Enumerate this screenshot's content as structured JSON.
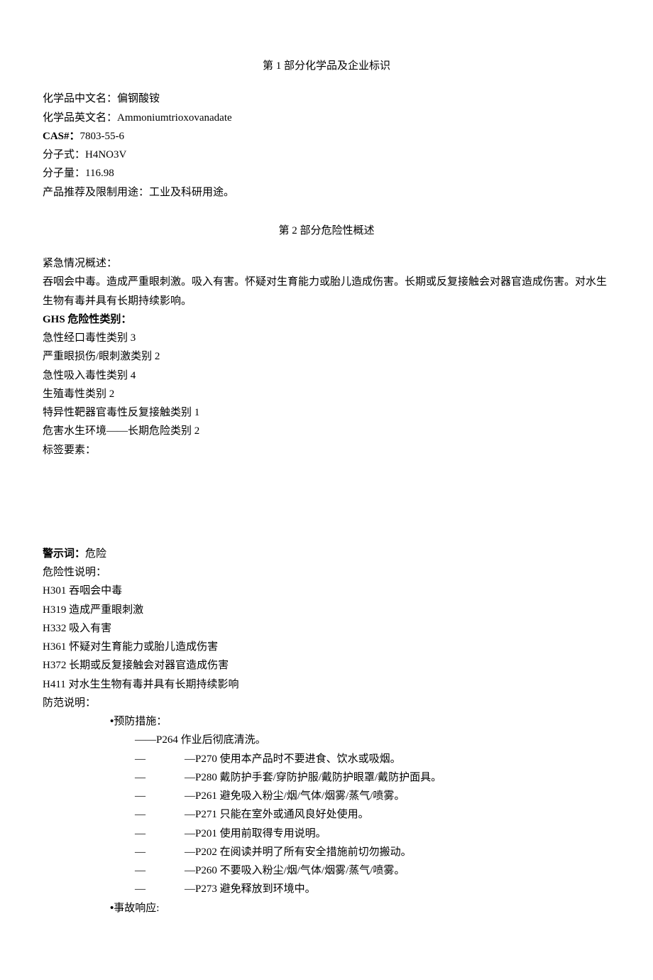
{
  "section1": {
    "title": "第 1 部分化学品及企业标识",
    "chinese_name_label": "化学品中文名：",
    "chinese_name_value": "偏钢酸铵",
    "english_name_label": "化学品英文名：",
    "english_name_value": "Ammoniumtrioxovanadate",
    "cas_label": "CAS#：",
    "cas_value": "7803-55-6",
    "formula_label": "分子式：",
    "formula_value": "H4NO3V",
    "mw_label": "分子量：",
    "mw_value": "116.98",
    "use_label": "产品推荐及限制用途：",
    "use_value": "工业及科研用途。"
  },
  "section2": {
    "title": "第 2 部分危险性概述",
    "emergency_label": "紧急情况概述：",
    "emergency_text": "吞咽会中毒。造成严重眼刺激。吸入有害。怀疑对生育能力或胎儿造成伤害。长期或反复接触会对器官造成伤害。对水生生物有毒并具有长期持续影响。",
    "ghs_label": "GHS 危险性类别：",
    "ghs_categories": [
      "急性经口毒性类别 3",
      "严重眼损伤/眼刺激类别 2",
      "急性吸入毒性类别 4",
      "生殖毒性类别 2",
      "特异性靶器官毒性反复接触类别 1",
      "危害水生环境——长期危险类别 2"
    ],
    "label_elements": "标签要素：",
    "signal_label": "警示词：",
    "signal_value": "危险",
    "hazard_label": "危险性说明：",
    "hazard_statements": [
      "H301 吞咽会中毒",
      "H319 造成严重眼刺激",
      "H332 吸入有害",
      "H361 怀疑对生育能力或胎儿造成伤害",
      "H372 长期或反复接触会对器官造成伤害",
      "H411 对水生生物有毒并具有长期持续影响"
    ],
    "precaution_label": "防范说明：",
    "prevention_header": "•预防措施：",
    "prevention_first": "——P264 作业后彻底清洗。",
    "prevention_items": [
      "—P270 使用本产品时不要进食、饮水或吸烟。",
      "—P280 戴防护手套/穿防护服/戴防护眼罩/戴防护面具。",
      "—P261 避免吸入粉尘/烟/气体/烟雾/蒸气/喷雾。",
      "—P271 只能在室外或通风良好处使用。",
      "—P201 使用前取得专用说明。",
      "—P202 在阅读并明了所有安全措施前切勿搬动。",
      "—P260 不要吸入粉尘/烟/气体/烟雾/蒸气/喷雾。",
      "—P273 避免释放到环境中。"
    ],
    "response_header": "•事故响应:"
  }
}
